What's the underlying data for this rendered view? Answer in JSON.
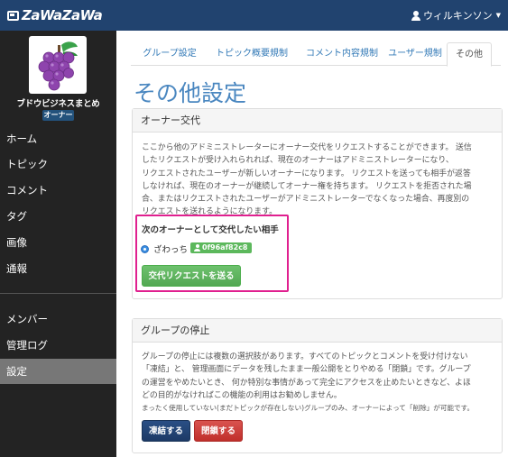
{
  "header": {
    "logo_text": "ZaWaZaWa",
    "user_name": "ウィルキンソン"
  },
  "sidebar": {
    "group_name": "ブドウビジネスまとめ",
    "role_badge": "オーナー",
    "items": [
      {
        "label": "ホーム"
      },
      {
        "label": "トピック"
      },
      {
        "label": "コメント"
      },
      {
        "label": "タグ"
      },
      {
        "label": "画像"
      },
      {
        "label": "通報"
      },
      {
        "label": "メンバー"
      },
      {
        "label": "管理ログ"
      },
      {
        "label": "設定"
      }
    ]
  },
  "tabs": [
    {
      "label": "グループ設定"
    },
    {
      "label": "トピック概要規制"
    },
    {
      "label": "コメント内容規制"
    },
    {
      "label": "ユーザー規制"
    },
    {
      "label": "その他"
    }
  ],
  "page_title": "その他設定",
  "owner_transfer": {
    "heading": "オーナー交代",
    "description": [
      "ここから他のアドミニストレーターにオーナー交代をリクエストすることができます。 送信",
      "したリクエストが受け入れられれば、現在のオーナーはアドミニストレーターになり、",
      "リクエストされたユーザーが新しいオーナーになります。 リクエストを送っても相手が返答",
      "しなければ、現在のオーナーが継続してオーナー権を持ちます。 リクエストを拒否された場",
      "合、またはリクエストされたユーザーがアドミニストレーターでなくなった場合、再度別の",
      "リクエストを送れるようになります。"
    ],
    "candidate_label": "次のオーナーとして交代したい相手",
    "candidate_name": "ざわっち",
    "candidate_id": "0f96af82c8",
    "submit_label": "交代リクエストを送る"
  },
  "group_suspend": {
    "heading": "グループの停止",
    "description": [
      "グループの停止には複数の選択肢があります。すべてのトピックとコメントを受け付けない",
      "「凍結」と、 管理画面にデータを残したまま一般公開をとりやめる「閉鎖」です。グループ",
      "の運営をやめたいとき、 何か特別な事情があって完全にアクセスを止めたいときなど、よほ",
      "どの目的がなければこの機能の利用はお勧めしません。"
    ],
    "note": "まったく使用していない(まだトピックが存在しない)グループのみ、オーナーによって「削除」が可能です。",
    "freeze_label": "凍結する",
    "close_label": "閉鎖する"
  },
  "colors": {
    "topbar": "#21436f",
    "sidebar": "#232323",
    "accent_blue": "#4a87c0",
    "highlight": "#e0208f",
    "success": "#5cb85c",
    "danger": "#d9534f"
  }
}
